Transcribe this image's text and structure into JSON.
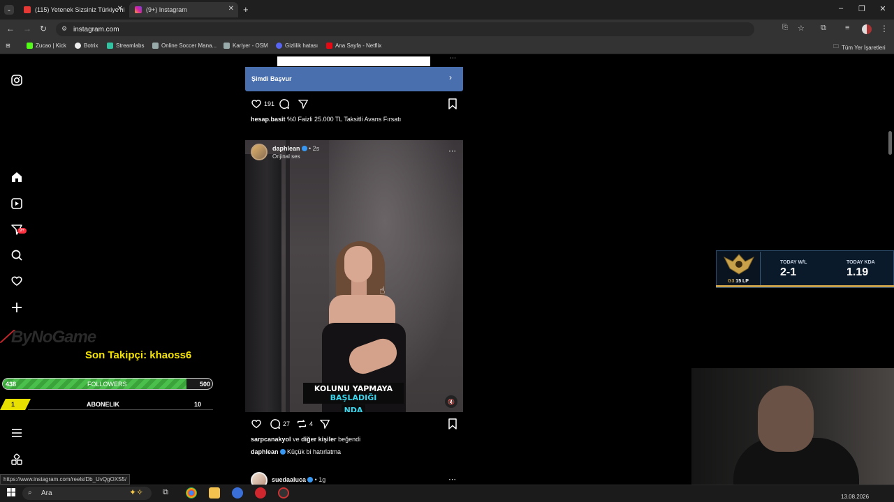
{
  "browser": {
    "tabs": [
      {
        "label": "(115) Yetenek Sizsiniz Türkiye'ni"
      },
      {
        "label": "(9+) Instagram"
      }
    ],
    "url": "instagram.com",
    "bookmarks": [
      "Zucao | Kick",
      "Botrix",
      "Streamlabs",
      "Online Soccer Mana...",
      "Kariyer - OSM",
      "Gizlilik hatası",
      "Ana Sayfa - Netflix"
    ],
    "all_bookmarks": "Tüm Yer İşaretleri",
    "status_url": "https://www.instagram.com/reels/Db_UvQgOXS5/"
  },
  "sidebar": {
    "notification_badge": "9+"
  },
  "overlay": {
    "brand": "ByNoGame",
    "last_follower": "Son Takipçi: khaoss6",
    "followers": {
      "label": "FOLLOWERS",
      "current": "438",
      "goal": "500",
      "progress": 0.876
    },
    "subs": {
      "label": "ABONELIK",
      "current": "1",
      "goal": "10"
    }
  },
  "feed": {
    "ad": {
      "cta": "Şimdi Başvur",
      "likes": "191",
      "author": "hesap.basit",
      "caption": "%0 Faizli 25.000 TL Taksitli Avans Fırsatı"
    },
    "post": {
      "author": "daphlean",
      "time": "• 2s",
      "audio": "Orijinal ses",
      "overlay_line1": "KOLUNU YAPMAYA",
      "overlay_line1_highlight": "BAŞLADIĞI",
      "overlay_line2": "NDA",
      "comments": "27",
      "reposts": "4",
      "liked_by_user": "sarpcanakyol",
      "liked_by_rest_joiner": "ve",
      "liked_by_others": "diğer kişiler",
      "liked_by_suffix": "beğendi",
      "caption_author": "daphlean",
      "caption": "Küçük bi hatırlatma"
    },
    "next_post": {
      "author": "suedaaluca",
      "time": "• 1g"
    }
  },
  "rank_widget": {
    "tier": "G3",
    "lp": "15 LP",
    "wl_label": "TODAY W/L",
    "wl_value": "2-1",
    "kda_label": "TODAY KDA",
    "kda_value": "1.19"
  },
  "taskbar": {
    "search_placeholder": "Ara",
    "date": "13.08.2026"
  },
  "colors": {
    "accent_blue": "#4a6fae",
    "badge_red": "#ff3040",
    "overlay_yellow": "#f5e400",
    "overlay_green": "#4bbf4b",
    "caption_cyan": "#3ad7ef"
  }
}
